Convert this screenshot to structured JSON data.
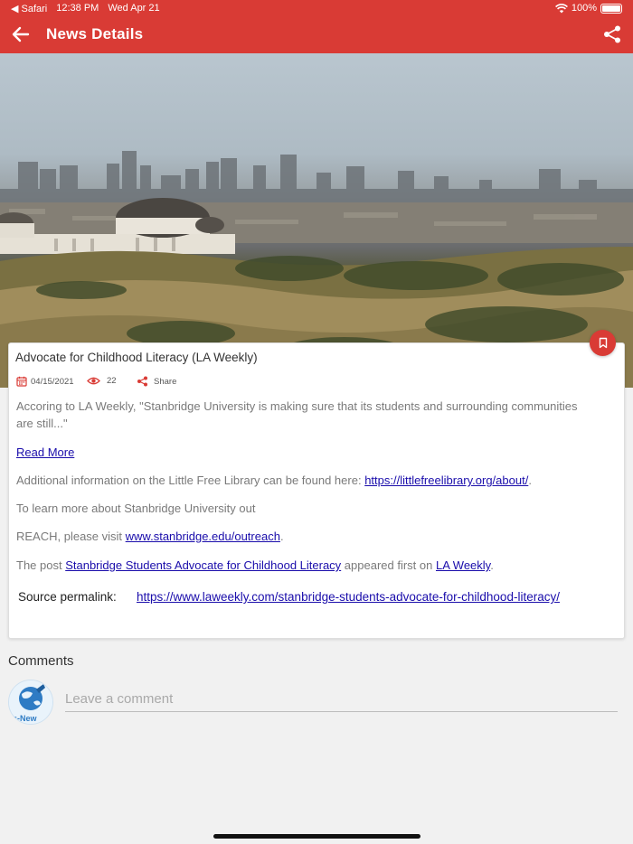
{
  "status_bar": {
    "back_app": "◀ Safari",
    "time": "12:38 PM",
    "date": "Wed Apr 21",
    "battery": "100%"
  },
  "app_bar": {
    "title": "News Details",
    "back_icon": "arrow-left-icon",
    "share_icon": "share-icon"
  },
  "colors": {
    "accent": "#d93b35",
    "link": "#1a0dab",
    "body_text": "#7a7a7a"
  },
  "article": {
    "title": "Advocate for Childhood Literacy (LA Weekly)",
    "date": "04/15/2021",
    "views": "22",
    "share_label": "Share",
    "excerpt": "Accoring to LA Weekly, \"Stanbridge University is making sure that its students and surrounding communities are still...\"",
    "read_more": "Read More",
    "additional_prefix": "Additional information on the Little Free Library can be found here: ",
    "additional_link": "https://littlefreelibrary.org/about/",
    "additional_suffix": ".",
    "learn_more": "To learn more about Stanbridge University out",
    "reach_prefix": "REACH, please visit ",
    "reach_link": "www.stanbridge.edu/outreach",
    "reach_suffix": ".",
    "post_prefix": "The post ",
    "post_link": "Stanbridge Students Advocate for Childhood Literacy",
    "post_middle": " appeared first on ",
    "post_source_link": "LA Weekly",
    "post_suffix": ".",
    "source_label": "Source permalink:",
    "source_url": "https://www.laweekly.com/stanbridge-students-advocate-for-childhood-literacy/"
  },
  "comments": {
    "heading": "Comments",
    "placeholder": "Leave a comment",
    "avatar_text": "s-New"
  }
}
